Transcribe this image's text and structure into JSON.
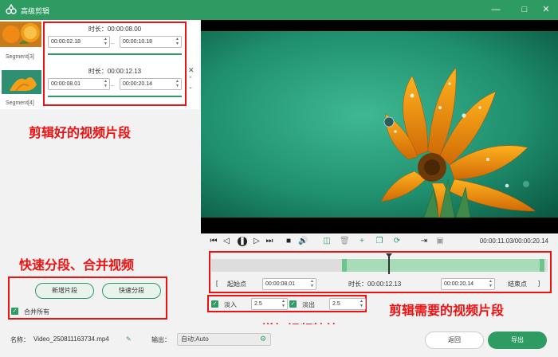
{
  "window": {
    "title": "高级剪辑"
  },
  "segments": [
    {
      "label": "Segment[3]",
      "duration": "时长：00:00:08.00",
      "start": "00:00:02.18",
      "end": "00:00:10.18"
    },
    {
      "label": "Segment[4]",
      "duration": "时长：00:00:12.13",
      "start": "00:00:08.01",
      "end": "00:00:20.14"
    }
  ],
  "annotations": {
    "segments": "剪辑好的视频片段",
    "split_merge": "快速分段、合并视频",
    "needed_segment": "剪辑需要的视频片段",
    "effects": "增加视频特效"
  },
  "left_actions": {
    "add_segment": "新增片段",
    "quick_split": "快速分段",
    "merge_all": "合并所有"
  },
  "player": {
    "time": "00:00:11.03/00:00:20.14"
  },
  "trim": {
    "start_btn": "起始点",
    "start_val": "00:00:08.01",
    "duration": "时长：00:00:12.13",
    "end_val": "00:00:20.14",
    "end_btn": "结束点"
  },
  "effects": {
    "fade_in_label": "淡入",
    "fade_in_val": "2.5",
    "fade_out_label": "淡出",
    "fade_out_val": "2.5"
  },
  "bottom": {
    "name_label": "名称：",
    "name_value": "Video_250811163734.mp4",
    "output_label": "输出：",
    "output_value": "自动;Auto",
    "back": "返回",
    "export": "导出"
  },
  "colors": {
    "accent": "#2e9b63",
    "annotation": "#e11111"
  }
}
